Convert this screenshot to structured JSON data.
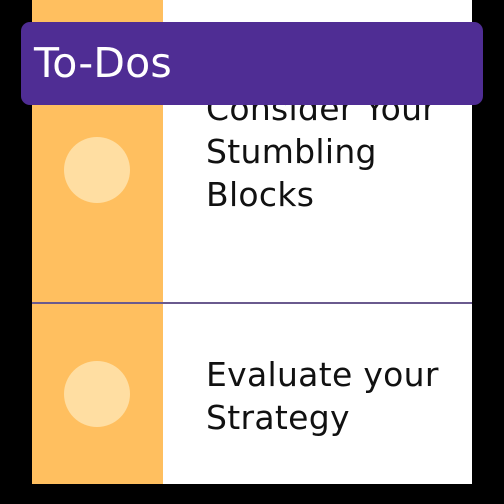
{
  "app_bar": {
    "title": "To-Dos"
  },
  "tasks": [
    {
      "label": "Consider Your Stumbling Blocks"
    },
    {
      "label": "Evaluate your Strategy"
    }
  ],
  "colors": {
    "app_bar": "#4f2d94",
    "strip": "#ffbf5f",
    "check_circle": "#ffdea2",
    "divider": "#6a5a8e",
    "background": "#000000"
  }
}
